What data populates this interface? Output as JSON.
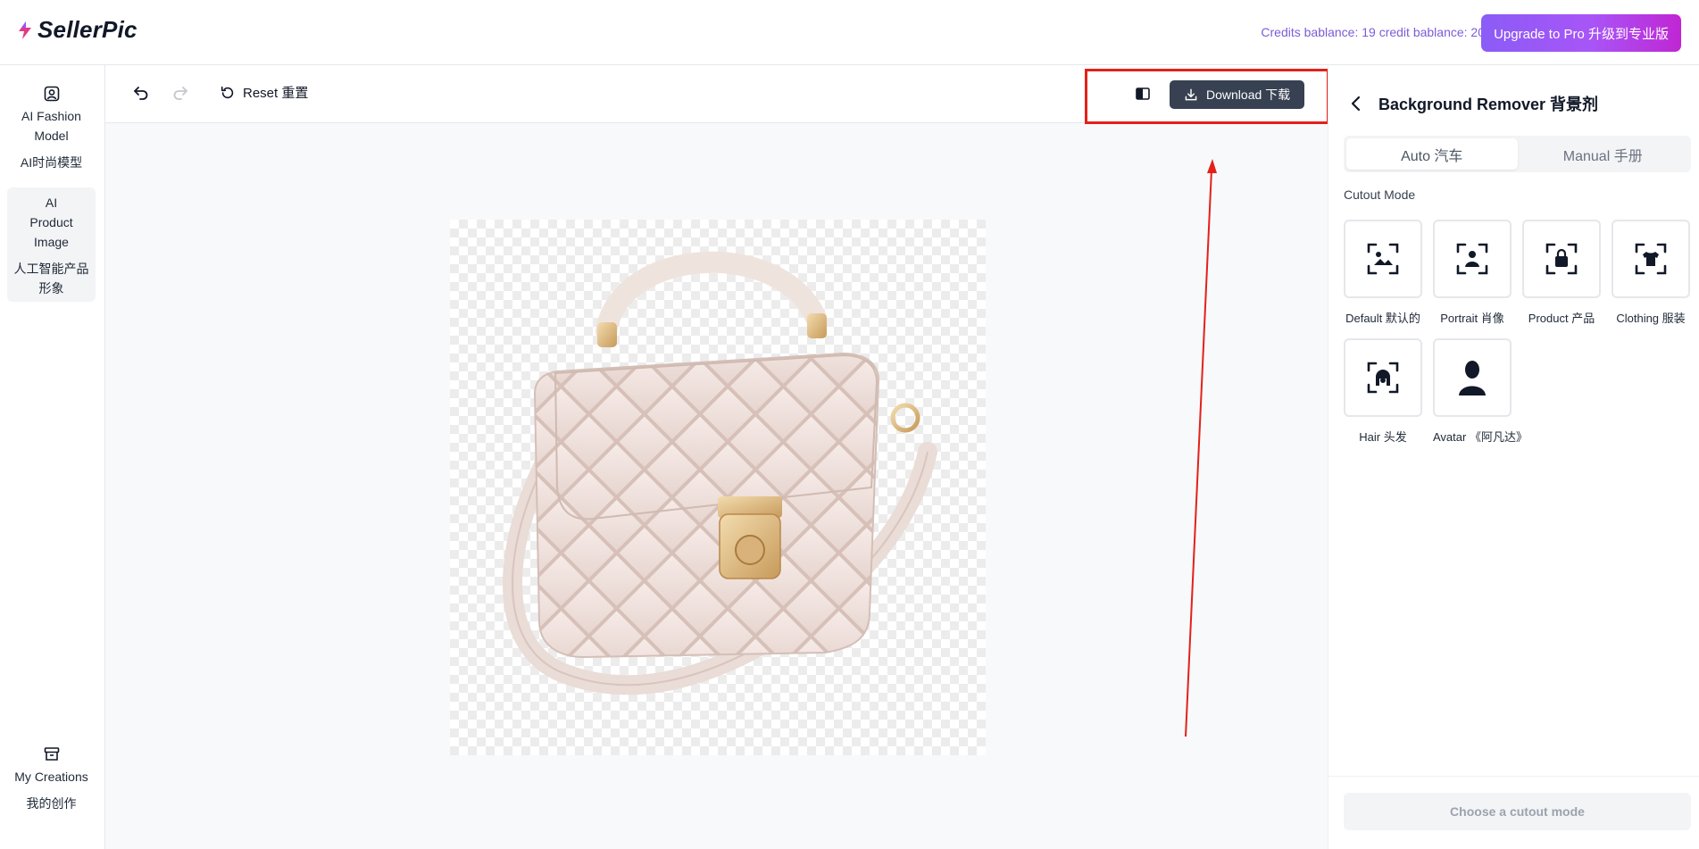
{
  "app": {
    "name": "SellerPic"
  },
  "header": {
    "credits_text": "Credits bablance: 19 credit bablance: 20",
    "upgrade_label": "Upgrade to Pro 升级到专业版"
  },
  "nav": {
    "items": [
      {
        "label_en": "AI Fashion Model",
        "label_zh": "AI时尚模型",
        "icon": "user-portrait-icon"
      },
      {
        "label_en": "AI Product Image",
        "label_zh": "人工智能产品形象",
        "icon": "product-image-icon",
        "active": true
      },
      {
        "label_en": "My Creations",
        "label_zh": "我的创作",
        "icon": "archive-box-icon"
      }
    ]
  },
  "toolbar": {
    "undo_icon": "undo-icon",
    "redo_icon": "redo-icon",
    "reset_label": "Reset 重置",
    "compare_icon": "compare-split-icon",
    "download_label": "Download 下载"
  },
  "canvas": {
    "image_subject": "quilted cream handbag (background removed)",
    "background": "transparency-checkerboard"
  },
  "panel": {
    "title": "Background Remover  背景剂",
    "tabs": [
      {
        "label": "Auto 汽车",
        "active": true
      },
      {
        "label": "Manual 手册",
        "active": false
      }
    ],
    "cutout_mode_label": "Cutout Mode",
    "modes": [
      {
        "label": "Default 默认的",
        "icon": "default-landscape-icon"
      },
      {
        "label": "Portrait 肖像",
        "icon": "portrait-person-icon"
      },
      {
        "label": "Product 产品",
        "icon": "product-bag-icon"
      },
      {
        "label": "Clothing 服装",
        "icon": "clothing-shirt-icon"
      },
      {
        "label": "Hair 头发",
        "icon": "hair-icon"
      },
      {
        "label": "Avatar 《阿凡达》",
        "icon": "avatar-silhouette-icon"
      }
    ],
    "choose_label": "Choose a cutout mode"
  },
  "colors": {
    "accent_purple": "#8b5cf6",
    "download_bg": "#374151",
    "annotation_red": "#e32119",
    "credits_text": "#7c5cd6"
  }
}
